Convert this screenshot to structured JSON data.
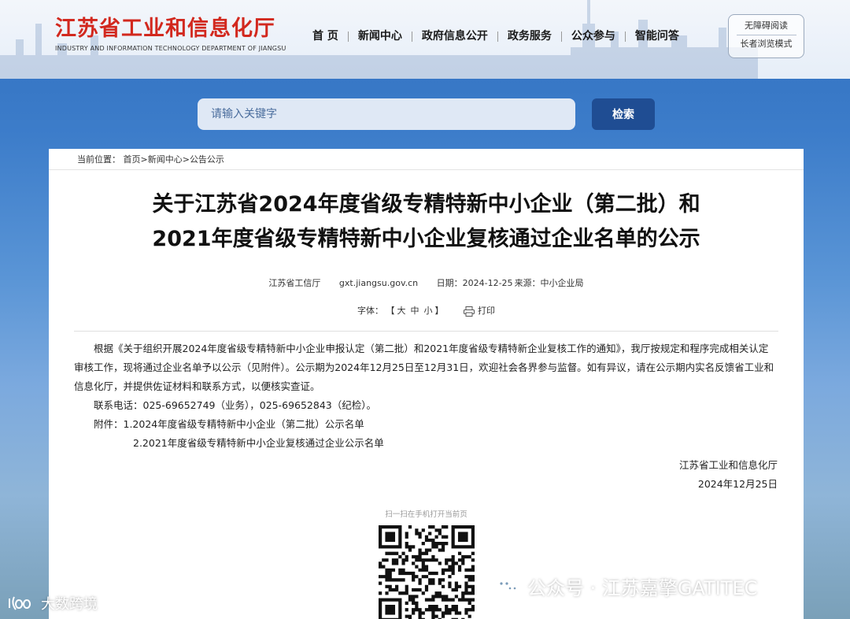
{
  "header": {
    "title_cn": "江苏省工业和信息化厅",
    "title_en": "INDUSTRY AND INFORMATION TECHNOLOGY DEPARTMENT OF JIANGSU",
    "nav": [
      "首 页",
      "新闻中心",
      "政府信息公开",
      "政务服务",
      "公众参与",
      "智能问答"
    ],
    "accessibility": {
      "barrier_free": "无障碍阅读",
      "elder_mode": "长者浏览模式"
    }
  },
  "search": {
    "placeholder": "请输入关键字",
    "button": "检索"
  },
  "breadcrumb": {
    "prefix": "当前位置：",
    "items": [
      "首页",
      "新闻中心",
      "公告公示"
    ],
    "sep": ">"
  },
  "article": {
    "title_line1": "关于江苏省2024年度省级专精特新中小企业（第二批）和",
    "title_line2": "2021年度省级专精特新中小企业复核通过企业名单的公示",
    "publisher": "江苏省工信厅",
    "site": "gxt.jiangsu.gov.cn",
    "date": "日期：2024-12-25",
    "source": "来源：中小企业局",
    "font_label": "字体：",
    "font_open": "【",
    "font_large": "大",
    "font_medium": "中",
    "font_small": "小",
    "font_close": "】",
    "print": "打印",
    "paragraph": "根据《关于组织开展2024年度省级专精特新中小企业申报认定（第二批）和2021年度省级专精特新企业复核工作的通知》，我厅按规定和程序完成相关认定审核工作，现将通过企业名单予以公示（见附件）。公示期为2024年12月25日至12月31日，欢迎社会各界参与监督。如有异议，请在公示期内实名反馈省工业和信息化厅，并提供佐证材料和联系方式，以便核实查证。",
    "contact": "联系电话：025-69652749（业务），025-69652843（纪检）。",
    "attachment1": "附件：1.2024年度省级专精特新中小企业（第二批）公示名单",
    "attachment2": "2.2021年度省级专精特新中小企业复核通过企业公示名单",
    "sign_org": "江苏省工业和信息化厅",
    "sign_date": "2024年12月25日",
    "qr_label": "扫一扫在手机打开当前页"
  },
  "watermarks": {
    "wechat": "公众号 · 江苏嘉擎GATITEC",
    "corner": "大数跨境"
  },
  "colors": {
    "brand_red": "#d2281e",
    "search_button": "#1f4d93",
    "sky_blue": "#3d7dca"
  }
}
